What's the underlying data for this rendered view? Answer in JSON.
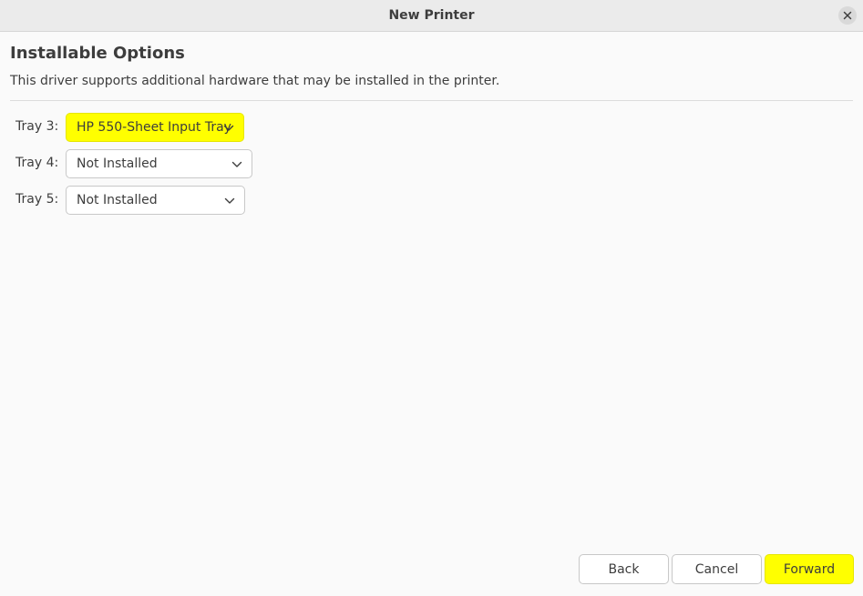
{
  "window": {
    "title": "New Printer"
  },
  "page": {
    "heading": "Installable Options",
    "description": "This driver supports additional hardware that may be installed in the printer."
  },
  "trays": [
    {
      "label": "Tray 3:",
      "value": "HP 550-Sheet Input Tray"
    },
    {
      "label": "Tray 4:",
      "value": "Not Installed"
    },
    {
      "label": "Tray 5:",
      "value": "Not Installed"
    }
  ],
  "buttons": {
    "back": "Back",
    "cancel": "Cancel",
    "forward": "Forward"
  },
  "colors": {
    "highlight": "#ffff00",
    "background": "#fafafa",
    "titlebar": "#ebebeb",
    "text": "#3d3d3d"
  },
  "icons": {
    "close": "close-icon",
    "dropdown": "chevron-down-icon"
  }
}
